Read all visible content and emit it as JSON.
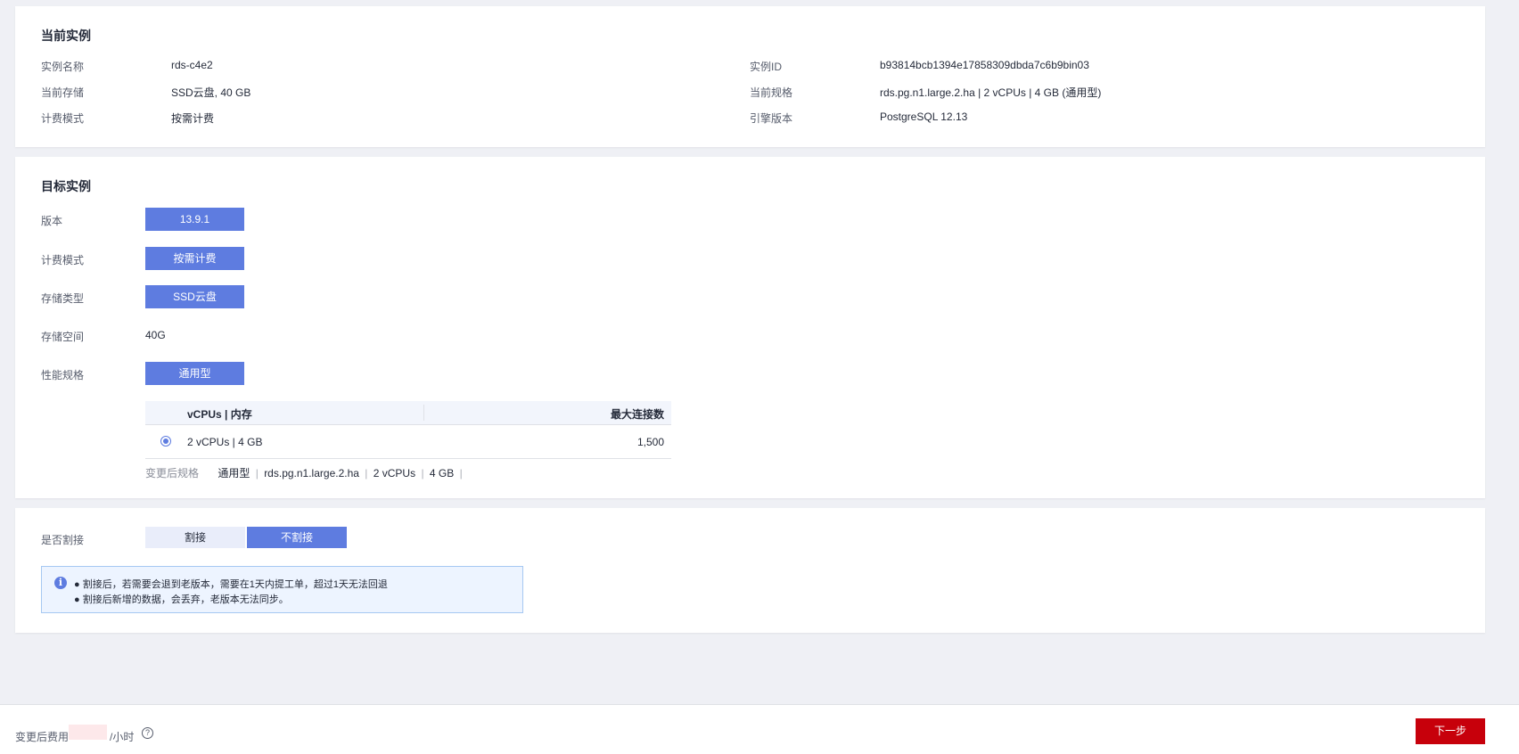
{
  "current_instance": {
    "title": "当前实例",
    "rows": [
      {
        "left_label": "实例名称",
        "left_value": "rds-c4e2",
        "right_label": "实例ID",
        "right_value": "b93814bcb1394e17858309dbda7c6b9bin03"
      },
      {
        "left_label": "当前存储",
        "left_value": "SSD云盘, 40 GB",
        "right_label": "当前规格",
        "right_value": "rds.pg.n1.large.2.ha | 2 vCPUs | 4 GB (通用型)"
      },
      {
        "left_label": "计费模式",
        "left_value": "按需计费",
        "right_label": "引擎版本",
        "right_value": "PostgreSQL 12.13"
      }
    ]
  },
  "target_instance": {
    "title": "目标实例",
    "version_label": "版本",
    "version_value": "13.9.1",
    "billing_label": "计费模式",
    "billing_value": "按需计费",
    "storage_type_label": "存储类型",
    "storage_type_value": "SSD云盘",
    "storage_space_label": "存储空间",
    "storage_space_value": "40G",
    "perf_label": "性能规格",
    "perf_value": "通用型",
    "spec_table": {
      "headers": [
        "vCPUs | 内存",
        "最大连接数"
      ],
      "rows": [
        {
          "spec": "2 vCPUs | 4 GB",
          "max_conn": "1,500",
          "selected": true
        }
      ]
    },
    "after_spec": {
      "label": "变更后规格",
      "type": "通用型",
      "flavor": "rds.pg.n1.large.2.ha",
      "cpu": "2 vCPUs",
      "mem": "4 GB"
    }
  },
  "cutover": {
    "label": "是否割接",
    "options": [
      "割接",
      "不割接"
    ],
    "selected": "不割接",
    "notice_lines": [
      "● 割接后，若需要会退到老版本，需要在1天内提工单，超过1天无法回退",
      "● 割接后新增的数据，会丢弃，老版本无法同步。"
    ]
  },
  "footer": {
    "cost_label": "变更后费用",
    "unit": "/小时",
    "help_glyph": "?",
    "next_button": "下一步"
  },
  "colors": {
    "primary": "#5e7ce0",
    "danger": "#c7000b",
    "page_bg": "#eff0f5",
    "notice_bg": "#edf4ff"
  },
  "icons": {
    "info": "info-icon",
    "help": "help-circle-icon"
  }
}
